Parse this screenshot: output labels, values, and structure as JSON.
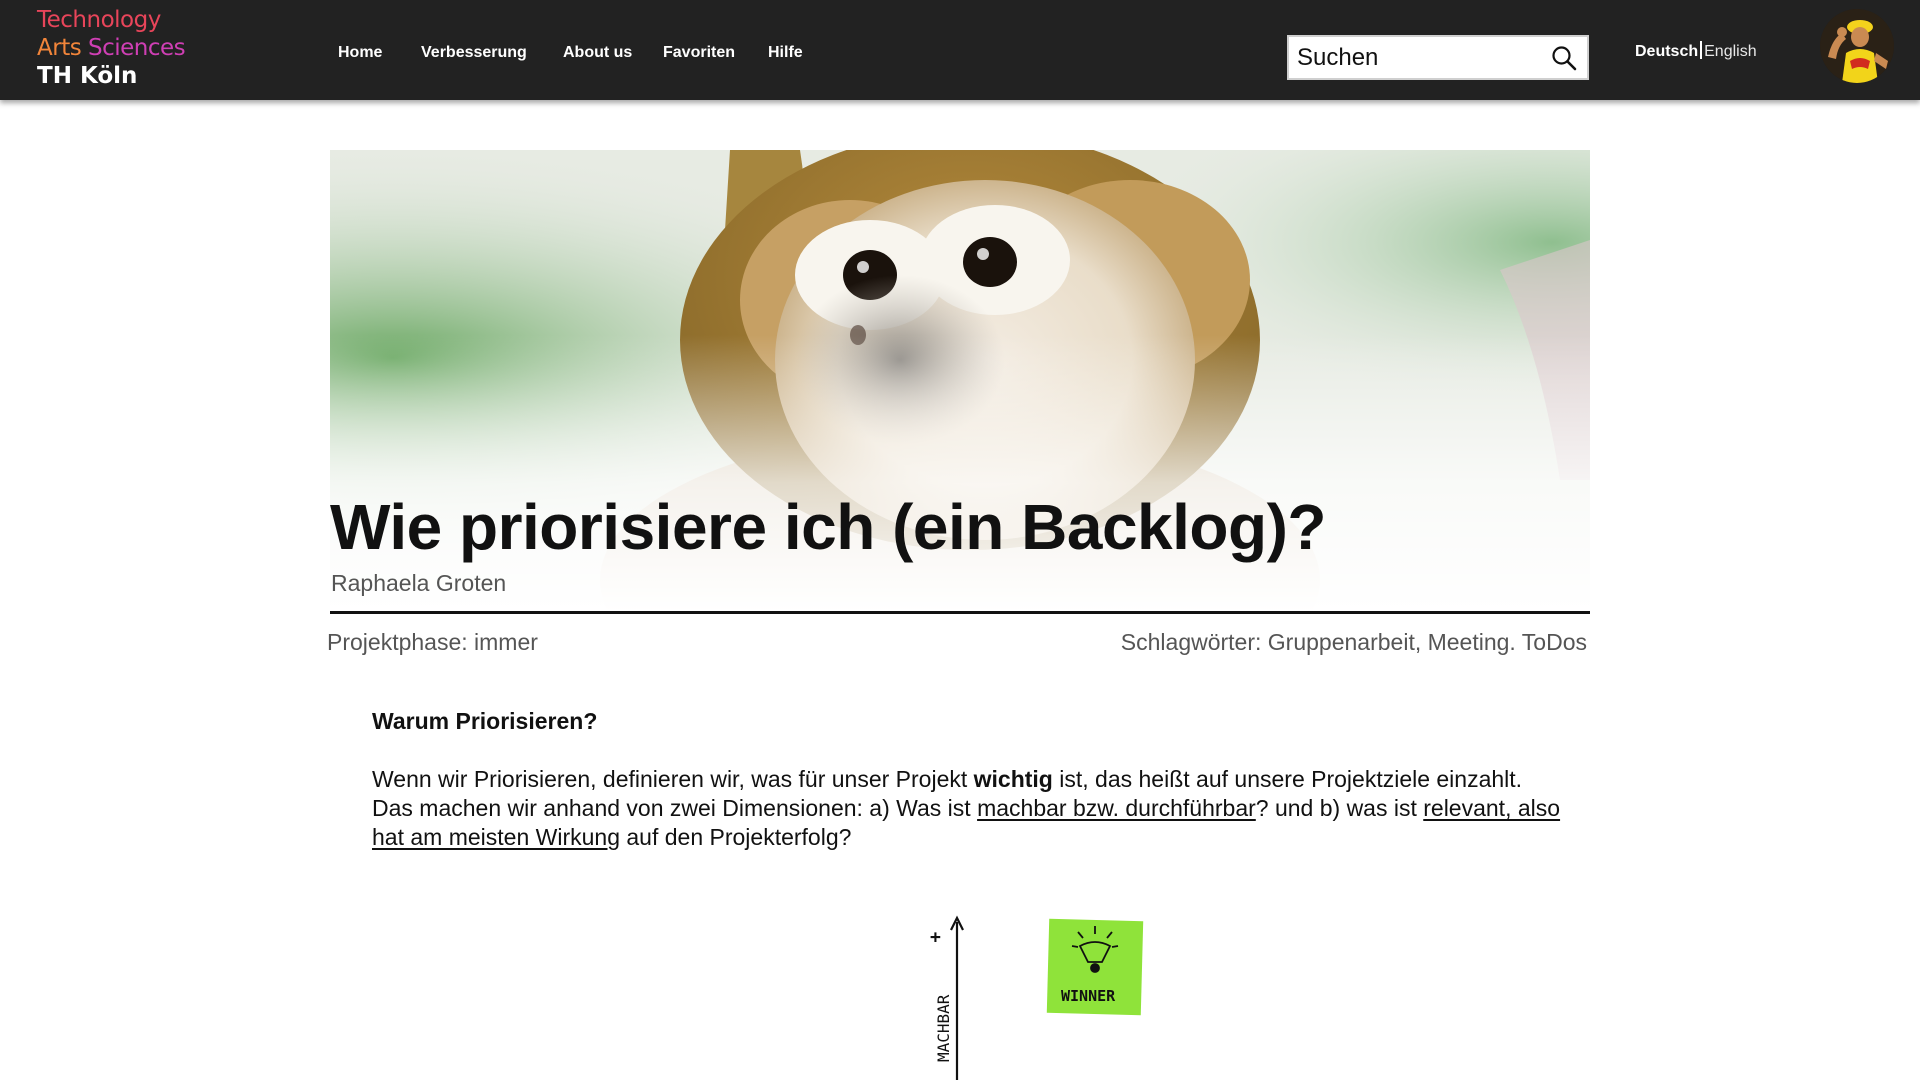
{
  "header": {
    "logo": {
      "line1": "Technology",
      "line2a": "Arts",
      "line2b": "Sciences",
      "line3": "TH Köln"
    },
    "nav": [
      {
        "label": "Home"
      },
      {
        "label": "Verbesserung"
      },
      {
        "label": "About us"
      },
      {
        "label": "Favoriten"
      },
      {
        "label": "Hilfe"
      }
    ],
    "search": {
      "placeholder": "Suchen",
      "icon": "search-icon"
    },
    "language": {
      "active": "Deutsch",
      "other": "English"
    },
    "avatar": {
      "icon": "user-avatar"
    }
  },
  "article": {
    "title": "Wie priorisiere ich (ein Backlog)?",
    "author": "Raphaela Groten",
    "phase": "Projektphase: immer",
    "tags": "Schlagwörter: Gruppenarbeit, Meeting. ToDos",
    "section_heading": "Warum Priorisieren?",
    "paragraph": {
      "p1": "Wenn wir Priorisieren, definieren wir, was für unser Projekt ",
      "bold": "wichtig",
      "p2": " ist, das heißt auf unsere Projektziele einzahlt. Das machen wir anhand von zwei Dimensionen: a) Was ist ",
      "link1": "machbar bzw. durchführbar",
      "p3": "? und b) was ist ",
      "link2": "relevant, also hat am meisten Wirkung",
      "p4": " auf den Projekterfolg?"
    },
    "diagram": {
      "y_axis_label": "MACHBAR",
      "plus_marker": "+",
      "sticky_label": "WINNER"
    }
  },
  "colors": {
    "header_bg": "#222222",
    "logo_red": "#e8455a",
    "logo_orange": "#f2853a",
    "logo_magenta": "#cf3fb4",
    "sticky_green": "#8fe33a"
  }
}
